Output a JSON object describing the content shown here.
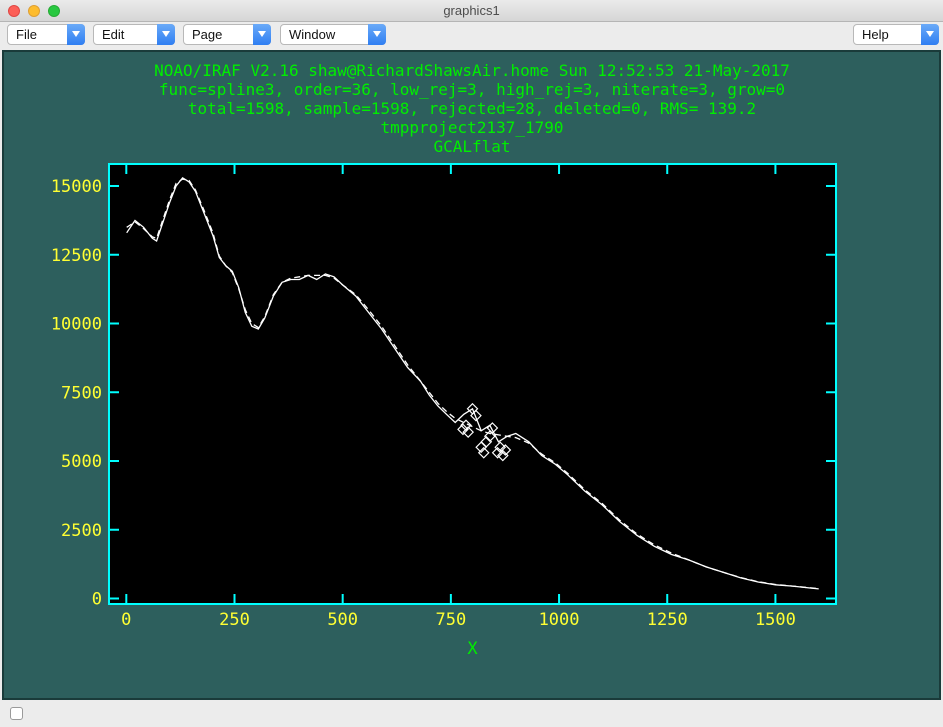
{
  "window": {
    "title": "graphics1"
  },
  "menus": [
    {
      "label": "File"
    },
    {
      "label": "Edit"
    },
    {
      "label": "Page"
    },
    {
      "label": "Window"
    },
    {
      "label": "Help"
    }
  ],
  "colors": {
    "background": "#2d5f5d",
    "header_text": "#00ee00",
    "axes": "#00ffff",
    "tick_labels": "#ffff33",
    "plot_bg": "#000000",
    "data": "#ffffff"
  },
  "chart_data": {
    "type": "line",
    "header": [
      "NOAO/IRAF V2.16 shaw@RichardShawsAir.home Sun 12:52:53 21-May-2017",
      "func=spline3, order=36, low_rej=3, high_rej=3, niterate=3, grow=0",
      "total=1598, sample=1598, rejected=28, deleted=0, RMS=  139.2",
      "tmpproject2137_1790",
      "GCALflat"
    ],
    "xlabel": "X",
    "ylabel": "",
    "xlim": [
      -40,
      1640
    ],
    "ylim": [
      -200,
      15800
    ],
    "xticks": [
      0,
      250,
      500,
      750,
      1000,
      1250,
      1500
    ],
    "yticks": [
      0,
      2500,
      5000,
      7500,
      10000,
      12500,
      15000
    ],
    "grid": false,
    "series": [
      {
        "style": "solid",
        "x": [
          1,
          20,
          40,
          60,
          70,
          85,
          100,
          115,
          130,
          145,
          160,
          180,
          200,
          215,
          230,
          245,
          260,
          275,
          290,
          305,
          320,
          340,
          360,
          380,
          400,
          420,
          440,
          460,
          480,
          500,
          530,
          560,
          590,
          620,
          650,
          680,
          700,
          720,
          740,
          760,
          780,
          800,
          820,
          840,
          860,
          880,
          900,
          930,
          960,
          990,
          1020,
          1060,
          1100,
          1140,
          1180,
          1220,
          1260,
          1300,
          1340,
          1380,
          1420,
          1460,
          1500,
          1540,
          1580,
          1600
        ],
        "y": [
          13300,
          13750,
          13500,
          13100,
          13000,
          13700,
          14400,
          15000,
          15300,
          15150,
          14800,
          14000,
          13200,
          12400,
          12100,
          11900,
          11300,
          10400,
          9900,
          9800,
          10200,
          11000,
          11500,
          11600,
          11600,
          11750,
          11600,
          11800,
          11700,
          11400,
          11000,
          10400,
          9800,
          9100,
          8400,
          7900,
          7400,
          7000,
          6700,
          6400,
          6700,
          6900,
          6100,
          6300,
          5700,
          5900,
          6000,
          5700,
          5200,
          4900,
          4500,
          3900,
          3400,
          2800,
          2300,
          1900,
          1600,
          1400,
          1150,
          950,
          750,
          600,
          500,
          450,
          380,
          350
        ]
      },
      {
        "style": "dashed",
        "x": [
          1,
          20,
          40,
          60,
          70,
          85,
          100,
          115,
          130,
          145,
          160,
          180,
          200,
          215,
          230,
          245,
          260,
          275,
          290,
          305,
          320,
          340,
          360,
          380,
          400,
          420,
          440,
          460,
          480,
          500,
          530,
          560,
          590,
          620,
          650,
          680,
          700,
          720,
          740,
          760,
          780,
          800,
          820,
          840,
          860,
          880,
          900,
          930,
          960,
          990,
          1020,
          1060,
          1100,
          1140,
          1180,
          1220,
          1260,
          1300,
          1340,
          1380,
          1420,
          1460,
          1500,
          1540,
          1580,
          1600
        ],
        "y": [
          13500,
          13700,
          13450,
          13150,
          13100,
          13800,
          14500,
          15100,
          15250,
          15200,
          14850,
          14100,
          13300,
          12450,
          12100,
          11850,
          11250,
          10500,
          10000,
          9850,
          10250,
          11050,
          11500,
          11650,
          11700,
          11750,
          11750,
          11750,
          11650,
          11400,
          11050,
          10500,
          9900,
          9200,
          8500,
          7900,
          7500,
          7100,
          6800,
          6550,
          6400,
          6250,
          6100,
          6000,
          5950,
          5900,
          5850,
          5650,
          5250,
          4950,
          4550,
          3950,
          3450,
          2850,
          2350,
          1950,
          1650,
          1400,
          1150,
          950,
          760,
          610,
          510,
          450,
          390,
          360
        ]
      }
    ],
    "rejected_points": {
      "x": [
        778,
        785,
        790,
        800,
        808,
        820,
        826,
        832,
        840,
        846,
        858,
        864,
        870,
        876
      ],
      "y": [
        6150,
        6300,
        6050,
        6900,
        6650,
        5500,
        5300,
        5700,
        5900,
        6200,
        5300,
        5500,
        5200,
        5400
      ]
    }
  }
}
